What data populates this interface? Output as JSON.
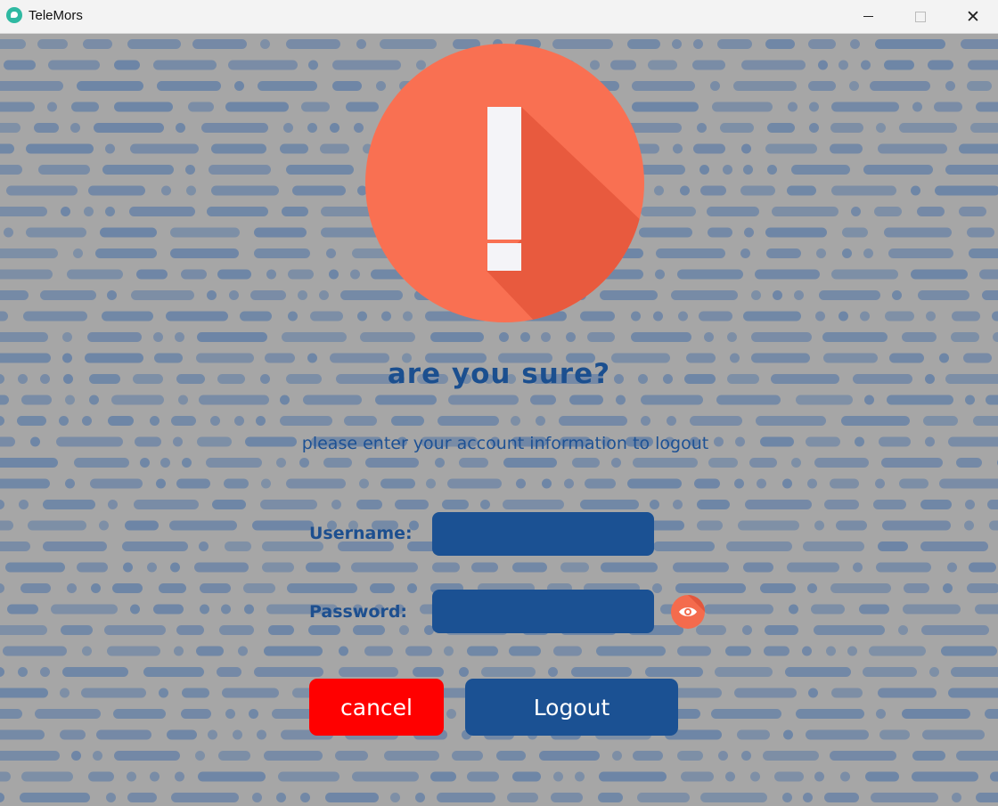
{
  "window": {
    "title": "TeleMors",
    "close_glyph": "✕"
  },
  "dialog": {
    "heading": "are you sure?",
    "subtitle": "please enter your account information to logout",
    "username_label": "Username:",
    "username_value": "",
    "password_label": "Password:",
    "password_value": "",
    "cancel_label": "cancel",
    "logout_label": "Logout"
  },
  "colors": {
    "background": "#a6a6a6",
    "pattern": "#5f7da6",
    "heading": "#1b4f8f",
    "field": "#1b5193",
    "cancel": "#ff0000",
    "warning_circle": "#f97052",
    "warning_shadow": "#e85a3e",
    "warning_mark": "#f4f4f8"
  },
  "icons": {
    "app": "app-chat-icon",
    "warning": "exclamation-warning-icon",
    "eye": "eye-icon"
  }
}
